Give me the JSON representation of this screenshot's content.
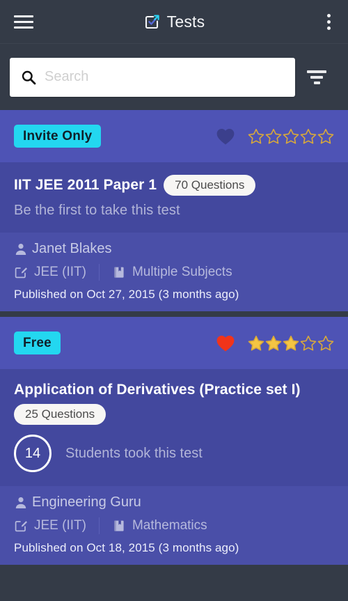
{
  "appbar": {
    "title": "Tests",
    "menu_icon": "hamburger-menu-icon",
    "app_icon": "tests-checkbox-arrow-icon",
    "overflow_icon": "more-vertical-icon"
  },
  "search": {
    "placeholder": "Search",
    "value": "",
    "search_icon": "magnifier-icon",
    "filter_icon": "filter-funnel-icon"
  },
  "colors": {
    "appbar_bg": "#343b47",
    "card_head_bg": "#4e53b5",
    "card_body_bg": "#43489e",
    "card_foot_bg": "#4a4fa8",
    "badge_cyan": "#23d7f0",
    "heart_active": "#f1341a",
    "heart_inactive": "#3b3f8c",
    "star_gold": "#f5c543",
    "star_outline": "#d9a93a"
  },
  "cards": [
    {
      "badge": "Invite Only",
      "favorited": false,
      "rating": 0,
      "max_rating": 5,
      "title": "IIT JEE 2011 Paper 1",
      "questions": "70 Questions",
      "subtext": "Be the first to take this test",
      "takers_count": null,
      "takers_text": null,
      "author": "Janet Blakes",
      "author_icon": "person-icon",
      "exam": "JEE (IIT)",
      "exam_icon": "edit-square-icon",
      "subject": "Multiple Subjects",
      "subject_icon": "book-icon",
      "published": "Published on Oct 27, 2015 (3 months ago)"
    },
    {
      "badge": "Free",
      "favorited": true,
      "rating": 3,
      "max_rating": 5,
      "title": "Application of Derivatives (Practice set I)",
      "questions": "25 Questions",
      "subtext": null,
      "takers_count": "14",
      "takers_text": "Students took this test",
      "author": "Engineering Guru",
      "author_icon": "person-icon",
      "exam": "JEE (IIT)",
      "exam_icon": "edit-square-icon",
      "subject": "Mathematics",
      "subject_icon": "book-icon",
      "published": "Published on Oct 18, 2015 (3 months ago)"
    }
  ]
}
